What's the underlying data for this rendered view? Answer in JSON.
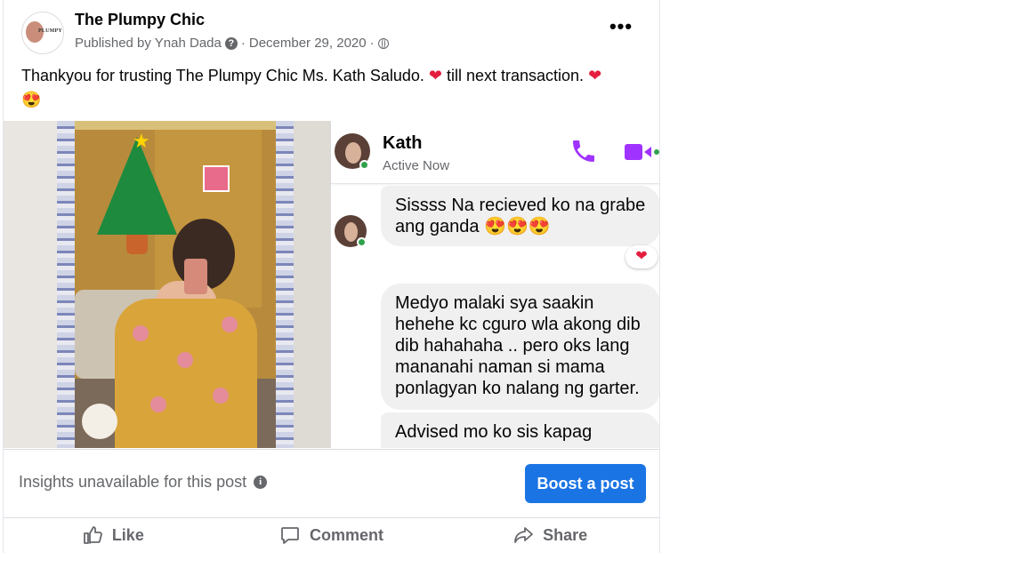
{
  "post": {
    "page_name": "The Plumpy Chic",
    "avatar_logo_text": "PLUMPY",
    "published_by": "Published by Ynah Dada",
    "separator": "·",
    "date": "December 29, 2020",
    "more_label": "•••",
    "caption_part1": "Thankyou for trusting The Plumpy Chic Ms. Kath Saludo. ",
    "caption_heart1": "❤",
    "caption_part2": " till next transaction. ",
    "caption_heart2": "❤",
    "caption_emoji": "😍"
  },
  "chat": {
    "contact_name": "Kath",
    "status": "Active Now",
    "messages": [
      "Sissss Na recieved ko na grabe ang ganda 😍😍😍",
      "Medyo malaki sya saakin hehehe kc cguro wla akong dib dib hahahaha .. pero oks lang mananahi naman si mama ponlagyan ko nalang ng garter.",
      "Advised mo ko sis kapag"
    ],
    "reaction": "❤",
    "accent_color": "#a033ff"
  },
  "insights": {
    "text": "Insights unavailable for this post",
    "info_icon": "i",
    "boost_label": "Boost a post"
  },
  "actions": {
    "like": "Like",
    "comment": "Comment",
    "share": "Share"
  },
  "colors": {
    "primary_blue": "#1b74e4",
    "secondary_text": "#65676b",
    "heart_red": "#e41e3f",
    "online_green": "#31a24c"
  }
}
